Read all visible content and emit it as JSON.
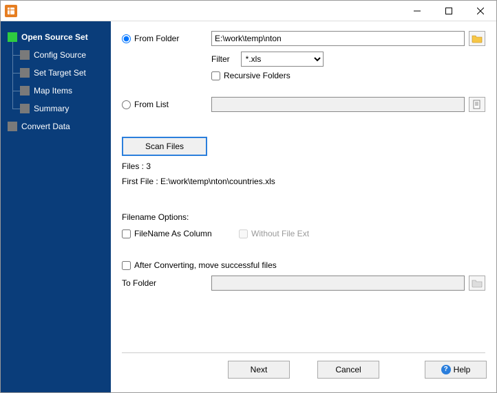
{
  "sidebar": {
    "items": [
      {
        "label": "Open Source Set",
        "active": true,
        "child": false
      },
      {
        "label": "Config Source",
        "active": false,
        "child": true
      },
      {
        "label": "Set Target Set",
        "active": false,
        "child": true
      },
      {
        "label": "Map Items",
        "active": false,
        "child": true
      },
      {
        "label": "Summary",
        "active": false,
        "child": true
      },
      {
        "label": "Convert Data",
        "active": false,
        "child": false
      }
    ]
  },
  "source": {
    "fromFolderLabel": "From Folder",
    "folderPath": "E:\\work\\temp\\nton",
    "filterLabel": "Filter",
    "filterValue": "*.xls",
    "recursiveLabel": "Recursive Folders",
    "fromListLabel": "From List",
    "listPath": "",
    "scanLabel": "Scan Files",
    "filesCount": "Files : 3",
    "firstFile": "First File : E:\\work\\temp\\nton\\countries.xls"
  },
  "filenameOptions": {
    "heading": "Filename Options:",
    "asColumnLabel": "FileName As Column",
    "withoutExtLabel": "Without File Ext"
  },
  "afterConvert": {
    "moveLabel": "After Converting, move successful files",
    "toFolderLabel": "To Folder",
    "toFolderPath": ""
  },
  "footer": {
    "next": "Next",
    "cancel": "Cancel",
    "help": "Help"
  }
}
